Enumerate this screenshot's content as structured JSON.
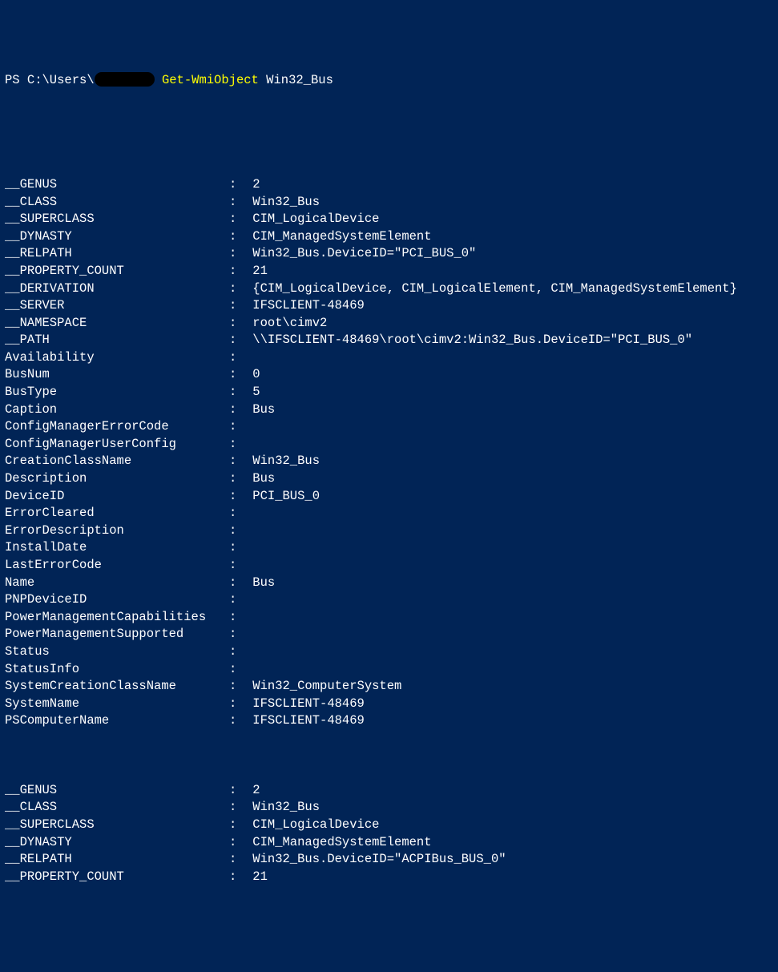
{
  "prompt": {
    "ps": "PS ",
    "path": "C:\\Users\\",
    "redacted": "        ",
    "space": " ",
    "cmdlet": "Get-WmiObject",
    "arg": " Win32_Bus"
  },
  "block1": {
    "rows": [
      {
        "k": "__GENUS",
        "v": "2"
      },
      {
        "k": "__CLASS",
        "v": "Win32_Bus"
      },
      {
        "k": "__SUPERCLASS",
        "v": "CIM_LogicalDevice"
      },
      {
        "k": "__DYNASTY",
        "v": "CIM_ManagedSystemElement"
      },
      {
        "k": "__RELPATH",
        "v": "Win32_Bus.DeviceID=\"PCI_BUS_0\""
      },
      {
        "k": "__PROPERTY_COUNT",
        "v": "21"
      },
      {
        "k": "__DERIVATION",
        "v": "{CIM_LogicalDevice, CIM_LogicalElement, CIM_ManagedSystemElement}"
      },
      {
        "k": "__SERVER",
        "v": "IFSCLIENT-48469"
      },
      {
        "k": "__NAMESPACE",
        "v": "root\\cimv2"
      },
      {
        "k": "__PATH",
        "v": "\\\\IFSCLIENT-48469\\root\\cimv2:Win32_Bus.DeviceID=\"PCI_BUS_0\""
      },
      {
        "k": "Availability",
        "v": ""
      },
      {
        "k": "BusNum",
        "v": "0"
      },
      {
        "k": "BusType",
        "v": "5"
      },
      {
        "k": "Caption",
        "v": "Bus"
      },
      {
        "k": "ConfigManagerErrorCode",
        "v": ""
      },
      {
        "k": "ConfigManagerUserConfig",
        "v": ""
      },
      {
        "k": "CreationClassName",
        "v": "Win32_Bus"
      },
      {
        "k": "Description",
        "v": "Bus"
      },
      {
        "k": "DeviceID",
        "v": "PCI_BUS_0"
      },
      {
        "k": "ErrorCleared",
        "v": ""
      },
      {
        "k": "ErrorDescription",
        "v": ""
      },
      {
        "k": "InstallDate",
        "v": ""
      },
      {
        "k": "LastErrorCode",
        "v": ""
      },
      {
        "k": "Name",
        "v": "Bus"
      },
      {
        "k": "PNPDeviceID",
        "v": ""
      },
      {
        "k": "PowerManagementCapabilities",
        "v": ""
      },
      {
        "k": "PowerManagementSupported",
        "v": ""
      },
      {
        "k": "Status",
        "v": ""
      },
      {
        "k": "StatusInfo",
        "v": ""
      },
      {
        "k": "SystemCreationClassName",
        "v": "Win32_ComputerSystem"
      },
      {
        "k": "SystemName",
        "v": "IFSCLIENT-48469"
      },
      {
        "k": "PSComputerName",
        "v": "IFSCLIENT-48469"
      }
    ]
  },
  "block2": {
    "rows": [
      {
        "k": "__GENUS",
        "v": "2"
      },
      {
        "k": "__CLASS",
        "v": "Win32_Bus"
      },
      {
        "k": "__SUPERCLASS",
        "v": "CIM_LogicalDevice"
      },
      {
        "k": "__DYNASTY",
        "v": "CIM_ManagedSystemElement"
      },
      {
        "k": "__RELPATH",
        "v": "Win32_Bus.DeviceID=\"ACPIBus_BUS_0\""
      },
      {
        "k": "__PROPERTY_COUNT",
        "v": "21"
      }
    ]
  }
}
